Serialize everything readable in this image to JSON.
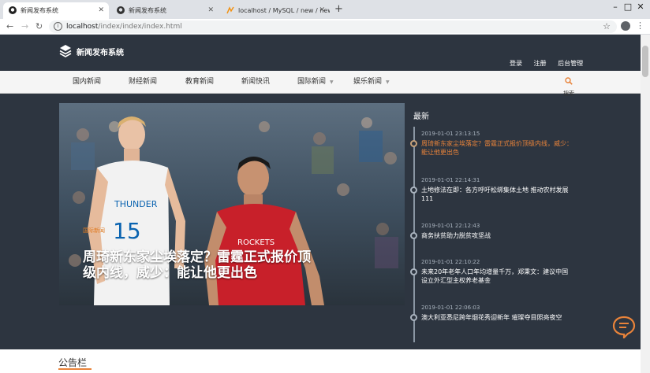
{
  "browser": {
    "tabs": [
      {
        "title": "新闻发布系统",
        "icon": "github-icon"
      },
      {
        "title": "新闻发布系统",
        "icon": "github-icon"
      },
      {
        "title": "localhost / MySQL / new / new",
        "icon": "phpmyadmin-icon"
      }
    ],
    "url_host": "localhost",
    "url_path": "/index/index/index.html"
  },
  "site": {
    "logo_text": "新闻发布系统",
    "top_links": [
      "登录",
      "注册",
      "后台管理"
    ],
    "nav": [
      {
        "label": "国内新闻",
        "caret": false
      },
      {
        "label": "财经新闻",
        "caret": false
      },
      {
        "label": "教育新闻",
        "caret": false
      },
      {
        "label": "新闻快讯",
        "caret": false
      },
      {
        "label": "国际新闻",
        "caret": true
      },
      {
        "label": "娱乐新闻",
        "caret": true
      }
    ],
    "search_label": "搜索"
  },
  "hero": {
    "tag": "国际新闻",
    "title": "周琦新东家尘埃落定？雷霆正式报价顶级内线，威少：能让他更出色"
  },
  "timeline": {
    "heading": "最新",
    "items": [
      {
        "time": "2019-01-01 23:13:15",
        "title": "周琦新东家尘埃落定？雷霆正式报价顶级内线，威少：能让他更出色",
        "highlighted": true
      },
      {
        "time": "2019-01-01 22:14:31",
        "title": "土地修法在即：各方呼吁松绑集体土地 推动农村发展111",
        "highlighted": false
      },
      {
        "time": "2019-01-01 22:12:43",
        "title": "商务扶贫助力脱贫攻坚战",
        "highlighted": false
      },
      {
        "time": "2019-01-01 22:10:22",
        "title": "未来20年老年人口年均增量千万，郑秉文：建议中国设立外汇型主权养老基金",
        "highlighted": false
      },
      {
        "time": "2019-01-01 22:06:03",
        "title": "澳大利亚悉尼跨年烟花秀迎新年 璀璨夺目照亮夜空",
        "highlighted": false
      }
    ]
  },
  "board": {
    "title": "公告栏"
  },
  "colors": {
    "page_bg": "#2d3540",
    "accent": "#e8833a"
  }
}
